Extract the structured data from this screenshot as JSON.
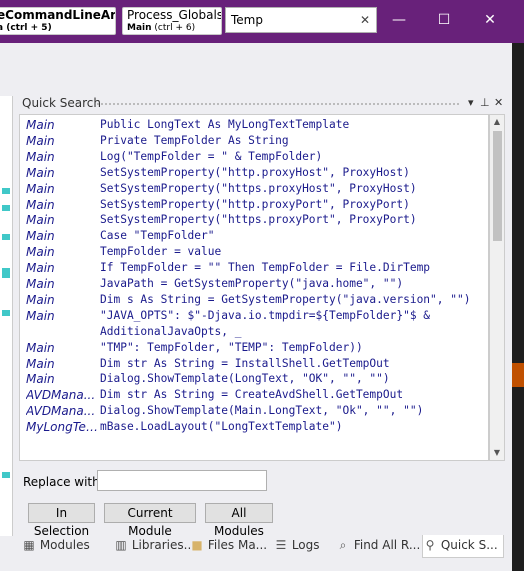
{
  "titlebar": {
    "tab1": {
      "title": "eCommandLineArgs",
      "module": "a",
      "shortcut": "(ctrl + 5)"
    },
    "tab2": {
      "title": "Process_Globals",
      "module": "Main",
      "shortcut": "(ctrl + 6)"
    },
    "search_value": "Temp",
    "search_clear": "✕",
    "minimize": "—",
    "maximize": "☐",
    "close": "✕"
  },
  "panel": {
    "title": "Quick Search",
    "dropdown_icon": "▾",
    "pin_icon": "⊥",
    "close_icon": "✕"
  },
  "results": [
    {
      "module": "Main",
      "text": "Public LongText As MyLongTextTemplate"
    },
    {
      "module": "Main",
      "text": "Private TempFolder As String"
    },
    {
      "module": "Main",
      "text": "Log(\"TempFolder = \" & TempFolder)"
    },
    {
      "module": "Main",
      "text": "SetSystemProperty(\"http.proxyHost\", ProxyHost)"
    },
    {
      "module": "Main",
      "text": "SetSystemProperty(\"https.proxyHost\", ProxyHost)"
    },
    {
      "module": "Main",
      "text": "SetSystemProperty(\"http.proxyPort\", ProxyPort)"
    },
    {
      "module": "Main",
      "text": "SetSystemProperty(\"https.proxyPort\", ProxyPort)"
    },
    {
      "module": "Main",
      "text": "Case \"TempFolder\""
    },
    {
      "module": "Main",
      "text": "TempFolder = value"
    },
    {
      "module": "Main",
      "text": "If TempFolder = \"\" Then TempFolder = File.DirTemp"
    },
    {
      "module": "Main",
      "text": "JavaPath = GetSystemProperty(\"java.home\", \"\")"
    },
    {
      "module": "Main",
      "text": "Dim s As String = GetSystemProperty(\"java.version\", \"\")"
    },
    {
      "module": "Main",
      "text": "\"JAVA_OPTS\": $\"-Djava.io.tmpdir=${TempFolder}\"$ &"
    },
    {
      "module": "",
      "text": "AdditionalJavaOpts, _"
    },
    {
      "module": "Main",
      "text": "\"TMP\": TempFolder, \"TEMP\": TempFolder))"
    },
    {
      "module": "Main",
      "text": "Dim str As String = InstallShell.GetTempOut"
    },
    {
      "module": "Main",
      "text": "Dialog.ShowTemplate(LongText, \"OK\", \"\", \"\")"
    },
    {
      "module": "AVDMana...",
      "text": "Dim str As String = CreateAvdShell.GetTempOut"
    },
    {
      "module": "AVDMana...",
      "text": "Dialog.ShowTemplate(Main.LongText, \"Ok\", \"\", \"\")"
    },
    {
      "module": "MyLongTex...",
      "text": "mBase.LoadLayout(\"LongTextTemplate\")"
    }
  ],
  "replace": {
    "label": "Replace with:",
    "value": ""
  },
  "buttons": {
    "in_selection": "In Selection",
    "current_module": "Current Module",
    "all_modules": "All Modules"
  },
  "bottom_tabs": [
    {
      "label": "Modules",
      "icon": "modules-icon"
    },
    {
      "label": "Libraries...",
      "icon": "libraries-icon"
    },
    {
      "label": "Files Ma...",
      "icon": "folder-icon"
    },
    {
      "label": "Logs",
      "icon": "logs-icon"
    },
    {
      "label": "Find All R...",
      "icon": "find-icon"
    },
    {
      "label": "Quick S...",
      "icon": "search-icon"
    }
  ]
}
